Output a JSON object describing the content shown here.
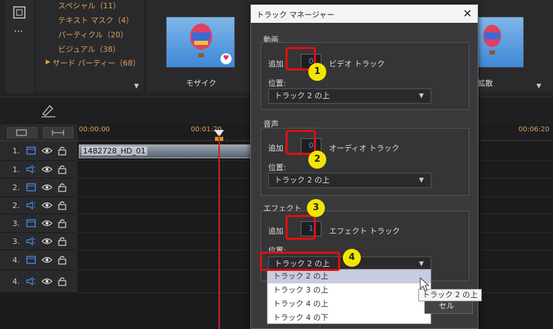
{
  "library": {
    "categories": [
      {
        "label": "スペシャル（11）"
      },
      {
        "label": "テキスト マスク（4）"
      },
      {
        "label": "パーティクル（20）"
      },
      {
        "label": "ビジュアル（38）"
      },
      {
        "label": "サード パーティー（68）"
      }
    ],
    "thumbs": [
      {
        "label": "モザイク"
      },
      {
        "label": "拡散"
      }
    ],
    "more_dots": "···"
  },
  "timeline": {
    "timecodes": [
      "00:00:00",
      "00:01:20",
      "00:06:20"
    ],
    "clip_label": "1482728_HD_01",
    "tracks": [
      {
        "num": "1.",
        "type": "video"
      },
      {
        "num": "1.",
        "type": "audio"
      },
      {
        "num": "2.",
        "type": "video"
      },
      {
        "num": "2.",
        "type": "audio"
      },
      {
        "num": "3.",
        "type": "video"
      },
      {
        "num": "3.",
        "type": "audio"
      },
      {
        "num": "4.",
        "type": "video"
      },
      {
        "num": "4.",
        "type": "audio"
      }
    ]
  },
  "dialog": {
    "title": "トラック マネージャー",
    "close": "✕",
    "video": {
      "section": "動画",
      "add_label": "追加",
      "count": "0",
      "suffix": "ビデオ トラック",
      "pos_label": "位置:",
      "position": "トラック 2 の上"
    },
    "audio": {
      "section": "音声",
      "add_label": "追加",
      "count": "0",
      "suffix": "オーディオ トラック",
      "pos_label": "位置:",
      "position": "トラック 2 の上"
    },
    "effect": {
      "section": "エフェクト",
      "add_label": "追加",
      "count": "1",
      "suffix": "エフェクト トラック",
      "pos_label": "位置:",
      "position": "トラック 2 の上"
    },
    "dropdown_options": [
      "トラック 2 の上",
      "トラック 3 の上",
      "トラック 4 の上",
      "トラック 4 の下"
    ],
    "tooltip": "トラック 2 の上",
    "cancel_partial": "セル"
  },
  "badges": [
    "1",
    "2",
    "3",
    "4"
  ],
  "colors": {
    "annotation_red": "#e01010",
    "badge_yellow": "#f2e600",
    "playhead": "#d02020",
    "category_text": "#d9a25a"
  }
}
